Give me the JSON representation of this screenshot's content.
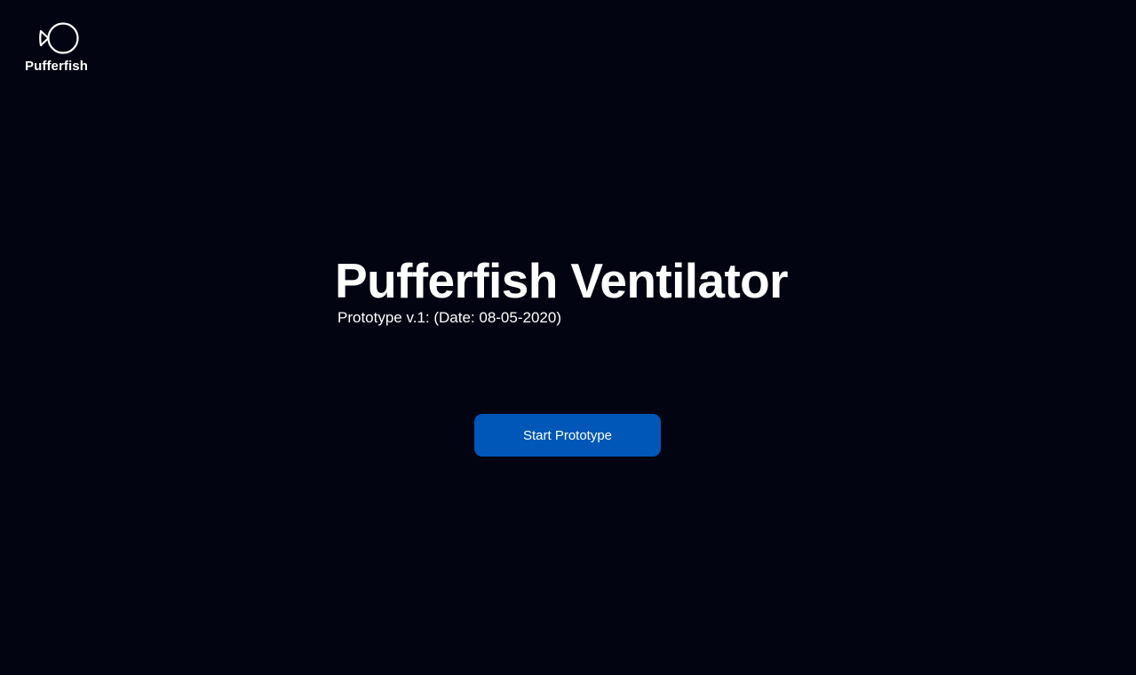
{
  "brand": {
    "logo_text": "Pufferfish",
    "logo_icon": "pufferfish-icon"
  },
  "hero": {
    "title": "Pufferfish Ventilator",
    "subtitle": "Prototype v.1: (Date: 08-05-2020)"
  },
  "actions": {
    "start_label": "Start Prototype"
  },
  "colors": {
    "background": "#020412",
    "text": "#ffffff",
    "primary_button": "#0057b8"
  }
}
